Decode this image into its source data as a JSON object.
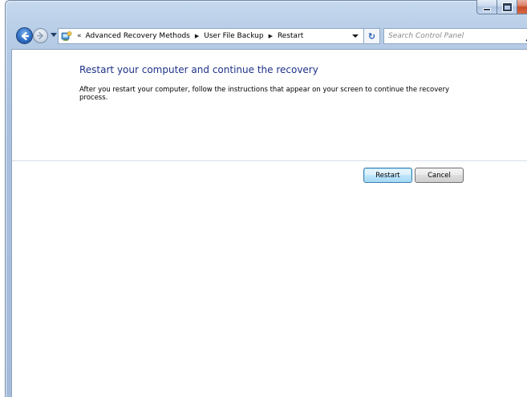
{
  "window": {
    "caption": {
      "minimize_icon": "minimize-icon",
      "maximize_icon": "maximize-icon",
      "close_label": "✕"
    }
  },
  "nav": {
    "back_icon": "back-arrow-icon",
    "forward_icon": "forward-arrow-icon",
    "breadcrumb_overflow": "«",
    "breadcrumbs": [
      {
        "label": "Advanced Recovery Methods"
      },
      {
        "label": "User File Backup"
      },
      {
        "label": "Restart"
      }
    ],
    "refresh_glyph": "↻"
  },
  "search": {
    "placeholder": "Search Control Panel"
  },
  "content": {
    "heading": "Restart your computer and continue the recovery",
    "instructions": "After you restart your computer, follow the instructions that appear on your screen to continue the recovery process."
  },
  "buttons": {
    "restart_label": "Restart",
    "cancel_label": "Cancel"
  },
  "colors": {
    "heading": "#1e3287",
    "frame": "#a9c1de",
    "close": "#c74a26"
  }
}
